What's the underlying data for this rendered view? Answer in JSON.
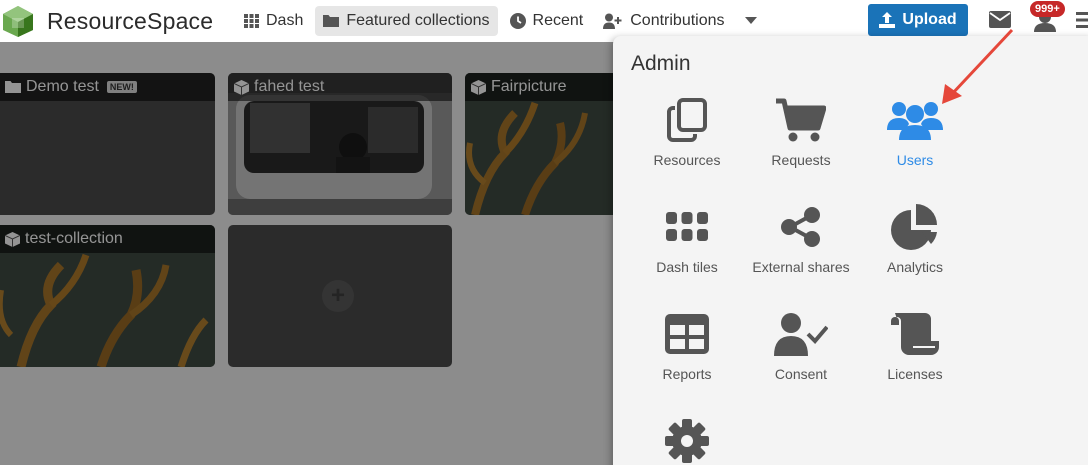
{
  "header": {
    "brand": "ResourceSpace",
    "nav": [
      {
        "label": "Dash",
        "icon": "grid-icon"
      },
      {
        "label": "Featured collections",
        "icon": "folder-icon",
        "active": true
      },
      {
        "label": "Recent",
        "icon": "clock-icon"
      },
      {
        "label": "Contributions",
        "icon": "user-plus-icon"
      }
    ],
    "upload_label": "Upload",
    "badge": "999+"
  },
  "collections": [
    {
      "title": "Demo test",
      "tag": "NEW!",
      "icon": "folder-icon"
    },
    {
      "title": "fahed test",
      "icon": "cube-icon"
    },
    {
      "title": "Fairpicture",
      "icon": "cube-icon"
    },
    {
      "title": "test-collection",
      "icon": "cube-icon"
    }
  ],
  "admin": {
    "title": "Admin",
    "items": [
      {
        "label": "Resources",
        "icon": "copy-icon"
      },
      {
        "label": "Requests",
        "icon": "cart-icon"
      },
      {
        "label": "Users",
        "icon": "users-icon",
        "selected": true
      },
      {
        "label": "Dash tiles",
        "icon": "tiles-icon"
      },
      {
        "label": "External shares",
        "icon": "share-icon"
      },
      {
        "label": "Analytics",
        "icon": "pie-chart-icon"
      },
      {
        "label": "Reports",
        "icon": "table-icon"
      },
      {
        "label": "Consent",
        "icon": "user-check-icon"
      },
      {
        "label": "Licenses",
        "icon": "scroll-icon"
      },
      {
        "label": "",
        "icon": "gear-icon"
      }
    ]
  },
  "colors": {
    "accent": "#2e8be6",
    "upload": "#1a73b8",
    "badge": "#c62828",
    "arrow": "#e5473a"
  }
}
